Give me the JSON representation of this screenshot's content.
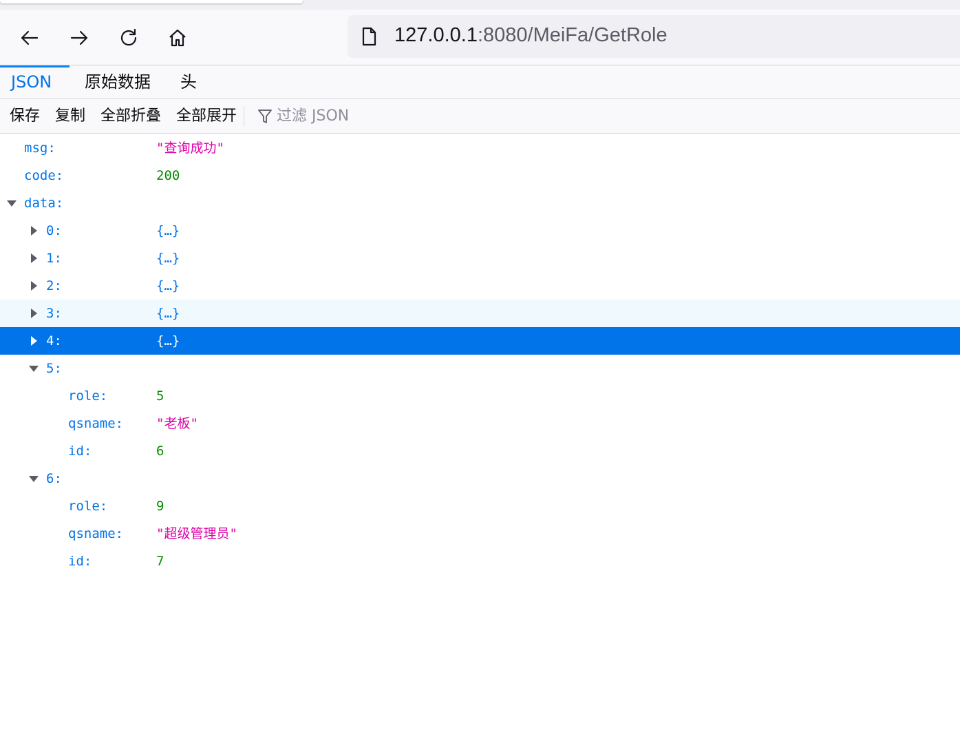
{
  "browser": {
    "url_host": "127.0.0.1",
    "url_rest": ":8080/MeiFa/GetRole"
  },
  "viewer_tabs": [
    "JSON",
    "原始数据",
    "头"
  ],
  "toolbar": {
    "save": "保存",
    "copy": "复制",
    "collapse_all": "全部折叠",
    "expand_all": "全部展开",
    "filter_placeholder": "过滤 JSON"
  },
  "json_tree": {
    "msg_key": "msg:",
    "msg_val": "\"查询成功\"",
    "code_key": "code:",
    "code_val": "200",
    "data_key": "data:",
    "collapsed_items": [
      {
        "key": "0:",
        "val": "{…}"
      },
      {
        "key": "1:",
        "val": "{…}"
      },
      {
        "key": "2:",
        "val": "{…}"
      },
      {
        "key": "3:",
        "val": "{…}"
      },
      {
        "key": "4:",
        "val": "{…}"
      }
    ],
    "item5": {
      "key": "5:",
      "role_key": "role:",
      "role_val": "5",
      "qsname_key": "qsname:",
      "qsname_val": "\"老板\"",
      "id_key": "id:",
      "id_val": "6"
    },
    "item6": {
      "key": "6:",
      "role_key": "role:",
      "role_val": "9",
      "qsname_key": "qsname:",
      "qsname_val": "\"超级管理员\"",
      "id_key": "id:",
      "id_val": "7"
    }
  },
  "colors": {
    "key": "#0074e8",
    "string": "#dd00a9",
    "number": "#058b00",
    "selected_row": "#0074e8",
    "hover_row": "#f0f9fe"
  }
}
